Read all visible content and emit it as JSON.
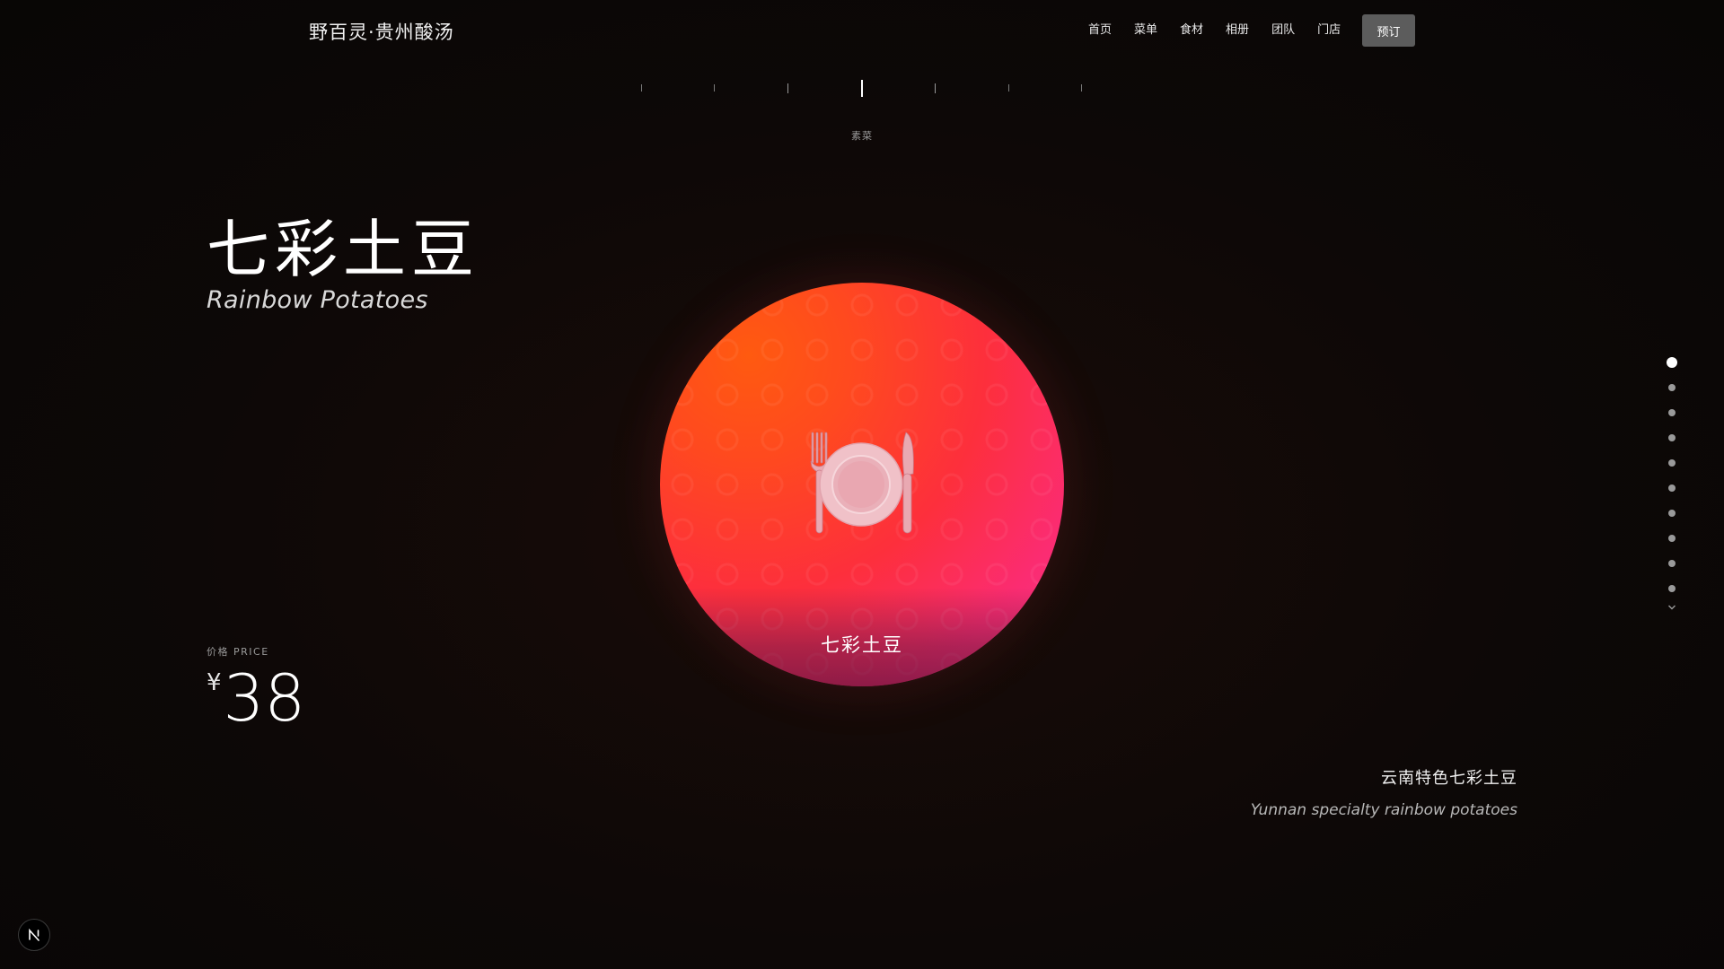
{
  "header": {
    "brand": "野百灵·贵州酸汤",
    "nav": [
      "首页",
      "菜单",
      "食材",
      "相册",
      "团队",
      "门店"
    ],
    "book_label": "预订"
  },
  "category": {
    "active": "素菜",
    "tick_count": 7,
    "active_index": 3
  },
  "dish": {
    "name_cn": "七彩土豆",
    "name_en": "Rainbow Potatoes",
    "caption": "七彩土豆",
    "icon": "fork-knife-plate-icon",
    "description_cn": "云南特色七彩土豆",
    "description_en": "Yunnan specialty rainbow potatoes"
  },
  "price": {
    "label": "价格 PRICE",
    "currency": "¥",
    "value": "38"
  },
  "pager": {
    "count": 10,
    "active_index": 0,
    "more_icon": "chevron-down-icon"
  },
  "badge": {
    "icon": "n-logo-icon",
    "letter": "N"
  },
  "colors": {
    "orb_start": "#ff5a10",
    "orb_mid": "#fd2f3c",
    "orb_end": "#f33a8c",
    "button_bg": "#5c5c5c"
  }
}
